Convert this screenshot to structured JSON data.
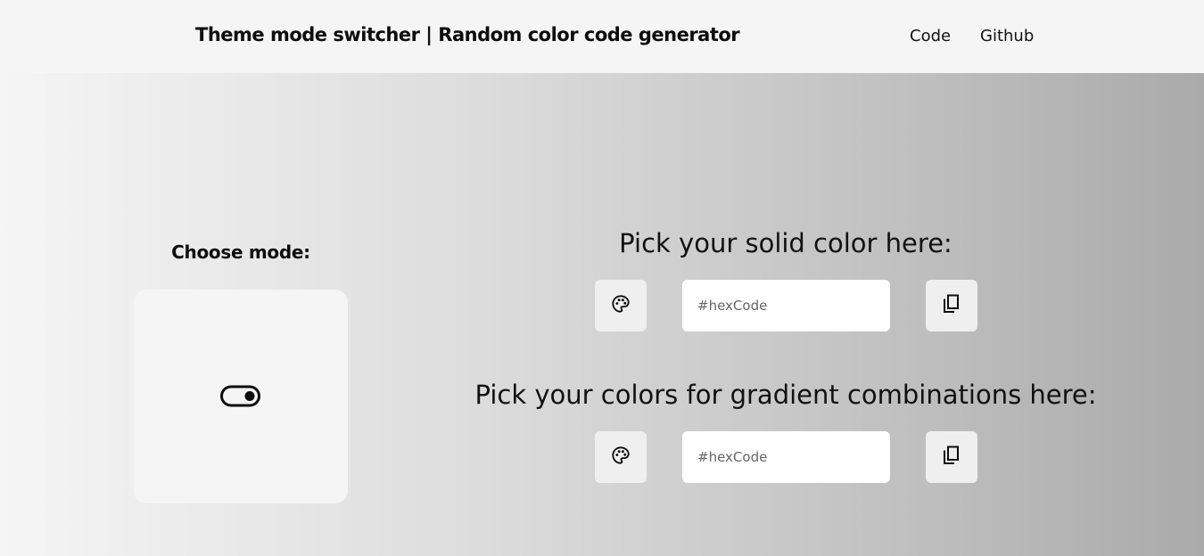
{
  "navbar": {
    "brand": "Theme mode switcher | Random color code generator",
    "links": [
      {
        "label": "Code"
      },
      {
        "label": "Github"
      }
    ]
  },
  "mode": {
    "title": "Choose mode:",
    "toggle_icon": "toggle-switch-icon"
  },
  "solid": {
    "title": "Pick your solid color here:",
    "palette_icon": "palette-icon",
    "input_placeholder": "#hexCode",
    "input_value": "",
    "copy_icon": "copy-icon"
  },
  "gradient": {
    "title": "Pick your colors for gradient combinations here:",
    "palette_icon": "palette-icon",
    "input_placeholder": "#hexCode",
    "input_value": "",
    "copy_icon": "copy-icon"
  },
  "colors": {
    "navbar_bg": "#f5f5f5",
    "gradient_start": "#f5f5f5",
    "gradient_end": "#aaaaaa",
    "button_bg": "#efefef",
    "input_bg": "#ffffff"
  }
}
